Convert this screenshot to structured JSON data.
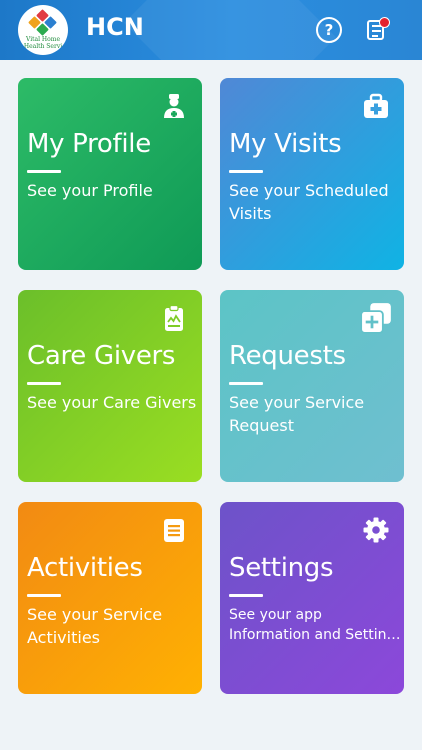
{
  "header": {
    "logo_text": "Vital Home Health Servi",
    "app_title": "HCN",
    "help_label": "?"
  },
  "tiles": [
    {
      "title": "My Profile",
      "subtitle": "See your Profile",
      "icon": "nurse-icon",
      "colors": [
        "#2dbb67",
        "#0f9a56"
      ]
    },
    {
      "title": "My Visits",
      "subtitle": "See your Scheduled Visits",
      "icon": "medical-kit-icon",
      "colors": [
        "#5088d6",
        "#10b3e4"
      ]
    },
    {
      "title": "Care Givers",
      "subtitle": "See your Care Givers",
      "icon": "clipboard-icon",
      "colors": [
        "#6bbf2a",
        "#9ade22"
      ]
    },
    {
      "title": "Requests",
      "subtitle": "See your Service Request",
      "icon": "add-copy-icon",
      "colors": [
        "#5cc4c6",
        "#6fbfd0"
      ]
    },
    {
      "title": "Activities",
      "subtitle": "See your Service Activities",
      "icon": "document-icon",
      "colors": [
        "#f28a13",
        "#ffb102"
      ]
    },
    {
      "title": "Settings",
      "subtitle": "See your app Information and Settings",
      "icon": "gear-icon",
      "colors": [
        "#6d53c9",
        "#8c48da"
      ]
    }
  ]
}
